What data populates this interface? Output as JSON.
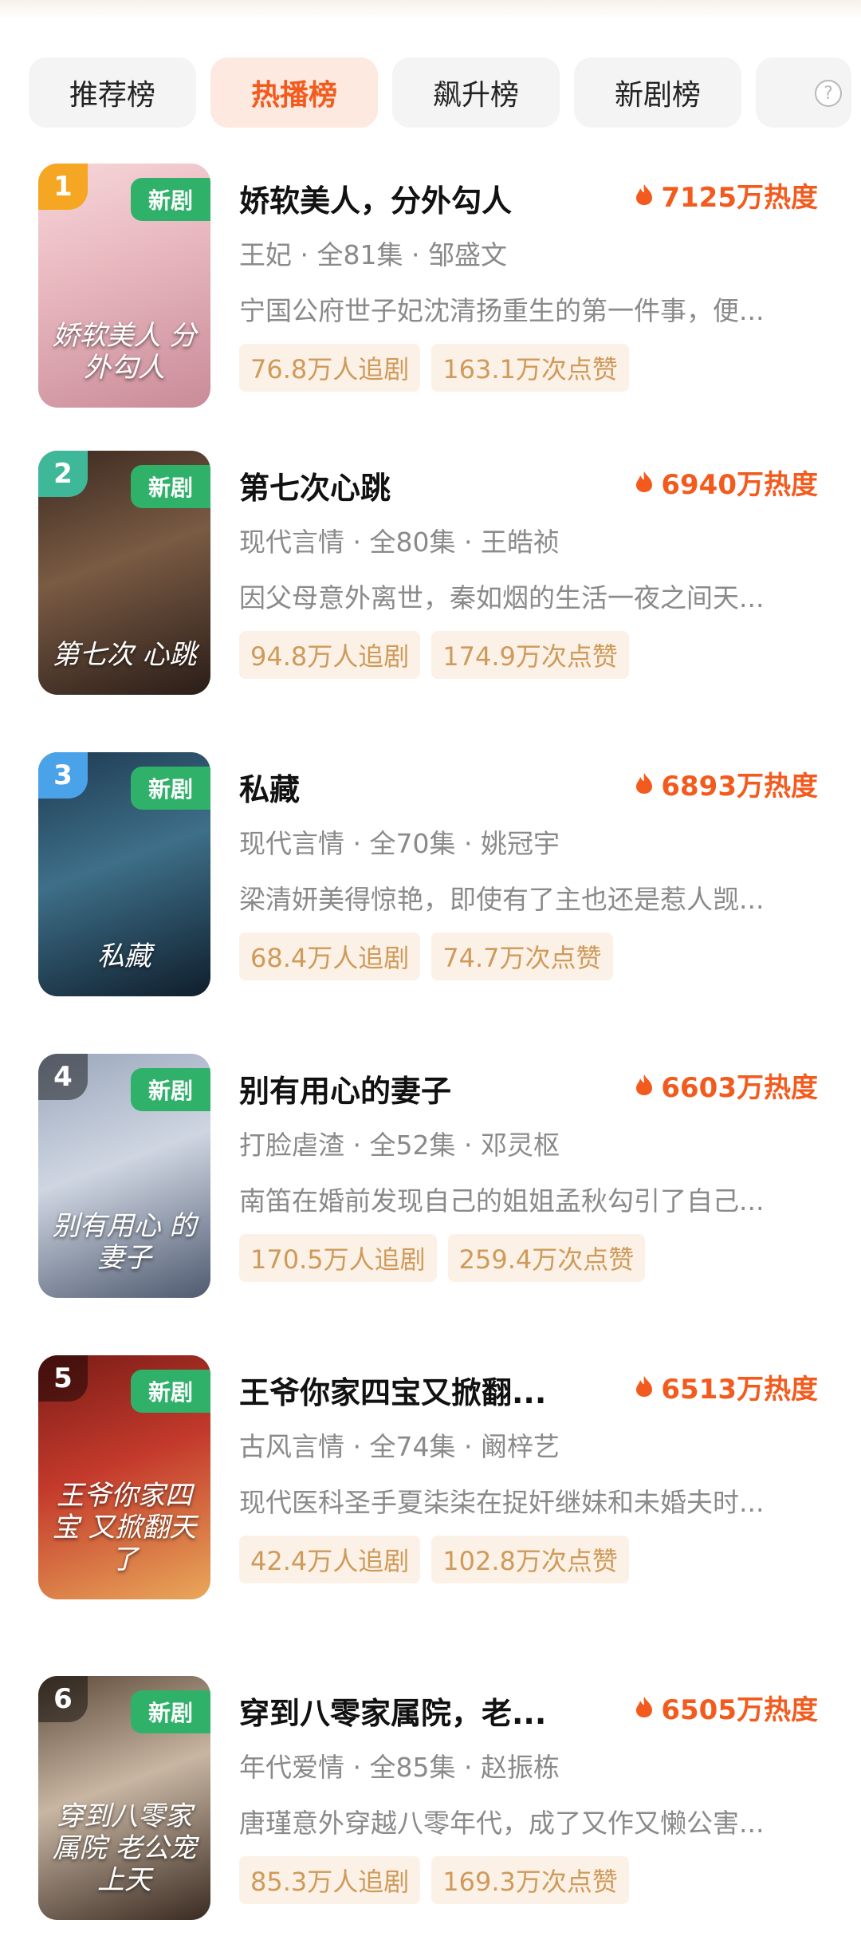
{
  "tabs": [
    {
      "label": "推荐榜",
      "active": false
    },
    {
      "label": "热播榜",
      "active": true
    },
    {
      "label": "飙升榜",
      "active": false
    },
    {
      "label": "新剧榜",
      "active": false
    },
    {
      "label": "",
      "active": false
    }
  ],
  "help_icon": "question-circle-icon",
  "colors": {
    "accent": "#f35b1e",
    "new_badge": "#2fb16a",
    "chip_bg": "#fbf1e6",
    "chip_text": "#cf9a5a",
    "rank_gold": "#f5a623",
    "rank_silver": "#3fb89a",
    "rank_bronze": "#4aa3e8",
    "rank_other": "rgba(0,0,0,0.45)"
  },
  "new_badge_label": "新剧",
  "items": [
    {
      "rank": "1",
      "title": "娇软美人，分外勾人",
      "heat": "7125万热度",
      "genre": "王妃",
      "episodes": "全81集",
      "actor": "邹盛文",
      "desc": "宁国公府世子妃沈清扬重生的第一件事，便...",
      "followers": "76.8万人追剧",
      "likes": "163.1万次点赞"
    },
    {
      "rank": "2",
      "title": "第七次心跳",
      "heat": "6940万热度",
      "genre": "现代言情",
      "episodes": "全80集",
      "actor": "王皓祯",
      "desc": "因父母意外离世，秦如烟的生活一夜之间天...",
      "followers": "94.8万人追剧",
      "likes": "174.9万次点赞"
    },
    {
      "rank": "3",
      "title": "私藏",
      "heat": "6893万热度",
      "genre": "现代言情",
      "episodes": "全70集",
      "actor": "姚冠宇",
      "desc": "梁清妍美得惊艳，即使有了主也还是惹人觊...",
      "followers": "68.4万人追剧",
      "likes": "74.7万次点赞"
    },
    {
      "rank": "4",
      "title": "别有用心的妻子",
      "heat": "6603万热度",
      "genre": "打脸虐渣",
      "episodes": "全52集",
      "actor": "邓灵枢",
      "desc": "南笛在婚前发现自己的姐姐孟秋勾引了自己...",
      "followers": "170.5万人追剧",
      "likes": "259.4万次点赞"
    },
    {
      "rank": "5",
      "title": "王爷你家四宝又掀翻...",
      "heat": "6513万热度",
      "genre": "古风言情",
      "episodes": "全74集",
      "actor": "阚梓艺",
      "desc": "现代医科圣手夏柒柒在捉奸继妹和未婚夫时...",
      "followers": "42.4万人追剧",
      "likes": "102.8万次点赞"
    },
    {
      "rank": "6",
      "title": "穿到八零家属院，老...",
      "heat": "6505万热度",
      "genre": "年代爱情",
      "episodes": "全85集",
      "actor": "赵振栋",
      "desc": "唐瑾意外穿越八零年代，成了又作又懒公害...",
      "followers": "85.3万人追剧",
      "likes": "169.3万次点赞"
    }
  ],
  "cover_titles": [
    "娇软美人 分外勾人",
    "第七次 心跳",
    "私藏",
    "别有用心 的妻子",
    "王爷你家四宝 又掀翻天了",
    "穿到八零家属院 老公宠上天"
  ]
}
